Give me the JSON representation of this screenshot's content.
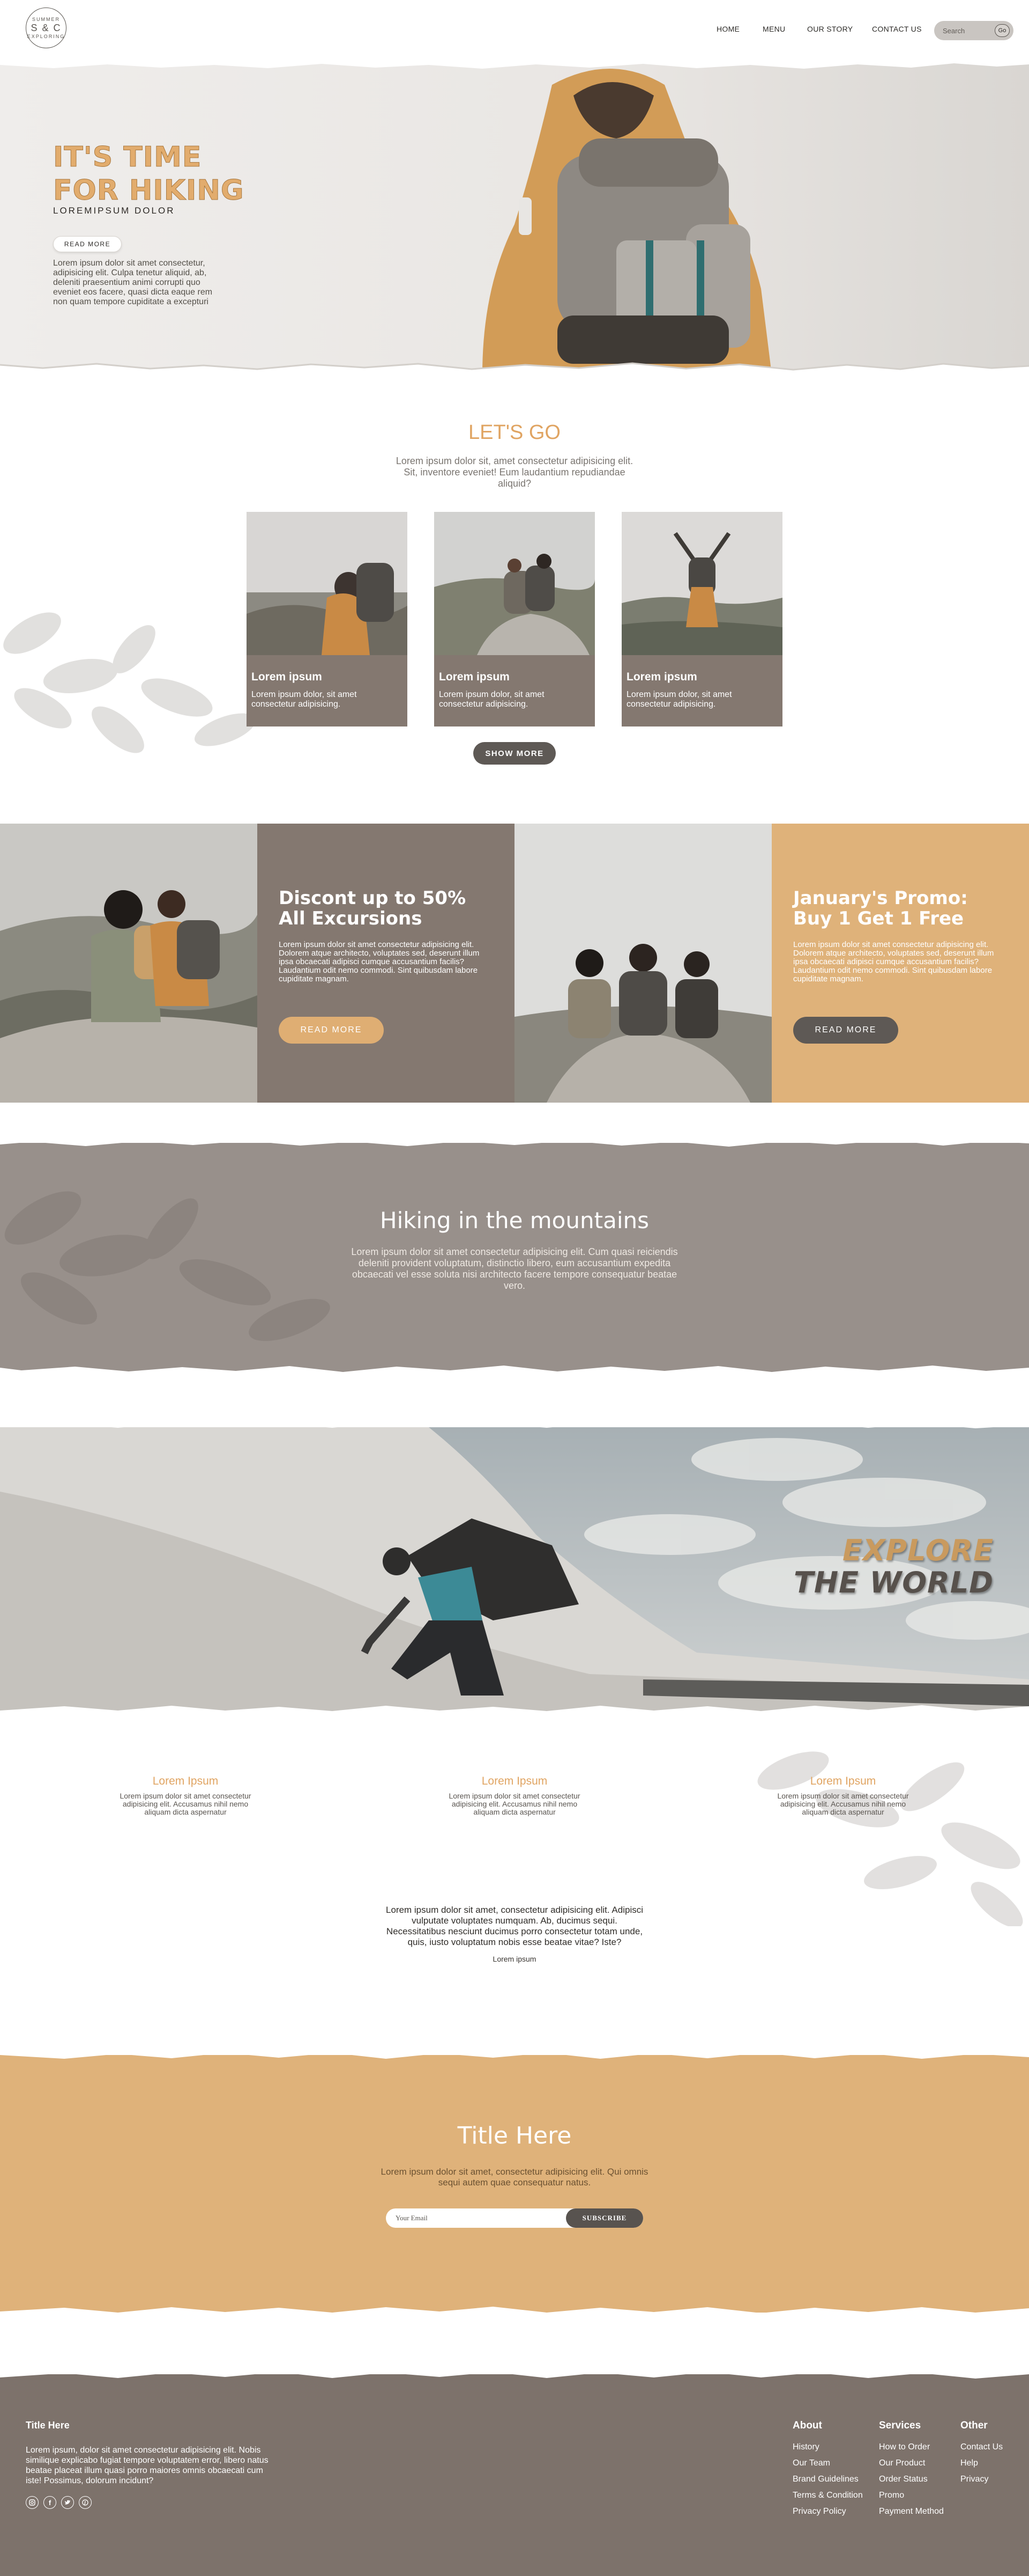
{
  "header": {
    "logo_text_top": "SUMMER",
    "logo_text_mid": "S & C",
    "logo_text_bottom": "EXPLORING",
    "nav": [
      "HOME",
      "MENU",
      "OUR STORY",
      "CONTACT US"
    ],
    "search_placeholder": "Search",
    "search_button": "Go"
  },
  "hero": {
    "title_line1": "IT'S TIME",
    "title_line2": "FOR HIKING",
    "subtitle": "LOREMIPSUM DOLOR",
    "button": "READ MORE",
    "description": "Lorem ipsum dolor sit amet consectetur, adipisicing elit. Culpa tenetur aliquid, ab, deleniti praesentium animi corrupti quo eveniet eos facere, quasi dicta eaque rem non quam tempore cupiditate a excepturi"
  },
  "lets_go": {
    "title": "LET'S GO",
    "description": "Lorem ipsum dolor sit, amet consectetur adipisicing elit. Sit, inventore eveniet! Eum laudantium repudiandae aliquid?",
    "cards": [
      {
        "title": "Lorem ipsum",
        "text": "Lorem ipsum dolor, sit amet consectetur adipisicing."
      },
      {
        "title": "Lorem ipsum",
        "text": "Lorem ipsum dolor, sit amet consectetur adipisicing."
      },
      {
        "title": "Lorem ipsum",
        "text": "Lorem ipsum dolor, sit amet consectetur adipisicing."
      }
    ],
    "button": "SHOW MORE"
  },
  "promos": [
    {
      "title": "Discont up to 50% All Excursions",
      "text": "Lorem ipsum dolor sit amet consectetur adipisicing elit. Dolorem atque architecto, voluptates sed, deserunt illum ipsa obcaecati adipisci cumque accusantium facilis? Laudantium odit nemo commodi. Sint quibusdam labore cupiditate magnam.",
      "button": "READ MORE"
    },
    {
      "title": "January's Promo: Buy 1 Get 1 Free",
      "text": "Lorem ipsum dolor sit amet consectetur adipisicing elit. Dolorem atque architecto, voluptates sed, deserunt illum ipsa obcaecati adipisci cumque accusantium facilis? Laudantium odit nemo commodi. Sint quibusdam labore cupiditate magnam.",
      "button": "READ MORE"
    }
  ],
  "mountains": {
    "title": "Hiking in the mountains",
    "description": "Lorem ipsum dolor sit amet consectetur adipisicing elit. Cum quasi reiciendis deleniti provident voluptatum, distinctio libero, eum accusantium expedita obcaecati vel esse soluta nisi architecto facere tempore consequatur beatae vero."
  },
  "explore": {
    "line1": "EXPLORE",
    "line2": "THE WORLD"
  },
  "features": [
    {
      "title": "Lorem Ipsum",
      "text": "Lorem ipsum dolor sit amet consectetur adipisicing elit. Accusamus nihil nemo aliquam dicta aspernatur"
    },
    {
      "title": "Lorem Ipsum",
      "text": "Lorem ipsum dolor sit amet consectetur adipisicing elit. Accusamus nihil nemo aliquam dicta aspernatur"
    },
    {
      "title": "Lorem Ipsum",
      "text": "Lorem ipsum dolor sit amet consectetur adipisicing elit. Accusamus nihil nemo aliquam dicta aspernatur"
    }
  ],
  "quote": {
    "text": "Lorem ipsum dolor sit amet, consectetur adipisicing elit. Adipisci vulputate voluptates numquam. Ab, ducimus sequi. Necessitatibus nesciunt ducimus porro consectetur totam unde, quis, iusto voluptatum nobis esse beatae vitae? Iste?",
    "author": "Lorem ipsum"
  },
  "newsletter": {
    "title": "Title Here",
    "description": "Lorem ipsum dolor sit amet, consectetur adipisicing elit. Qui omnis sequi autem quae consequatur natus.",
    "email_placeholder": "Your Email",
    "button": "SUBSCRIBE"
  },
  "footer": {
    "title": "Title Here",
    "description": "Lorem ipsum, dolor sit amet consectetur adipisicing elit. Nobis similique explicabo fugiat tempore voluptatem error, libero natus beatae placeat illum quasi porro maiores omnis obcaecati cum iste! Possimus, dolorum incidunt?",
    "social_icons": [
      "instagram-icon",
      "facebook-icon",
      "twitter-icon",
      "pinterest-icon"
    ],
    "columns": [
      {
        "heading": "About",
        "links": [
          "History",
          "Our Team",
          "Brand Guidelines",
          "Terms & Condition",
          "Privacy Policy"
        ]
      },
      {
        "heading": "Services",
        "links": [
          "How to Order",
          "Our Product",
          "Order Status",
          "Promo",
          "Payment Method"
        ]
      },
      {
        "heading": "Other",
        "links": [
          "Contact Us",
          "Help",
          "Privacy"
        ]
      }
    ]
  },
  "colors": {
    "accent_tan": "#e0a462",
    "panel_brown": "#847870",
    "band_gray": "#98908b",
    "newsletter_tan": "#dfb27a",
    "footer_brown": "#7d726b",
    "button_dark": "#5e5955"
  }
}
